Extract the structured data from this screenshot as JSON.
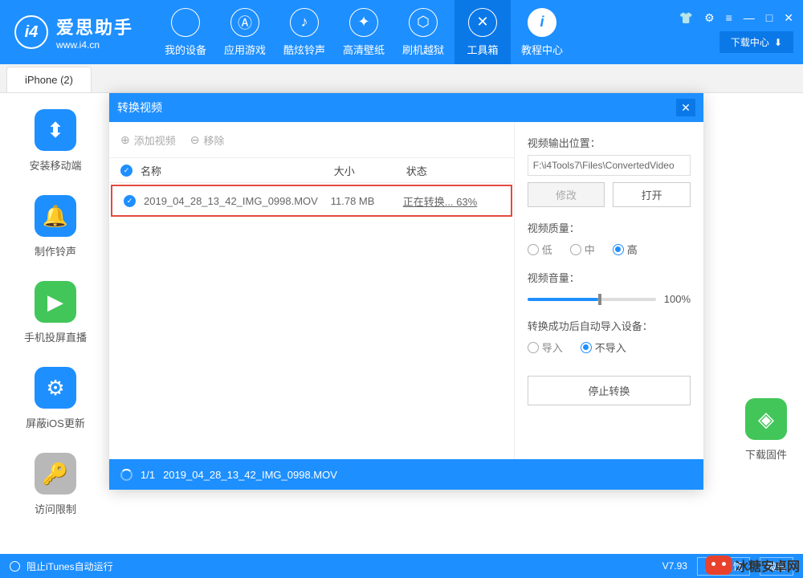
{
  "app": {
    "name": "爱思助手",
    "url": "www.i4.cn"
  },
  "nav": [
    {
      "label": "我的设备"
    },
    {
      "label": "应用游戏"
    },
    {
      "label": "酷炫铃声"
    },
    {
      "label": "高清壁纸"
    },
    {
      "label": "刷机越狱"
    },
    {
      "label": "工具箱"
    },
    {
      "label": "教程中心"
    }
  ],
  "download_center": "下载中心",
  "tab": "iPhone (2)",
  "sidebar": [
    {
      "label": "安装移动端"
    },
    {
      "label": "制作铃声"
    },
    {
      "label": "手机投屏直播"
    },
    {
      "label": "屏蔽iOS更新"
    },
    {
      "label": "访问限制"
    }
  ],
  "right_item": {
    "label": "下载固件"
  },
  "modal": {
    "title": "转换视频",
    "toolbar": {
      "add": "添加视频",
      "remove": "移除"
    },
    "cols": {
      "name": "名称",
      "size": "大小",
      "status": "状态"
    },
    "row": {
      "name": "2019_04_28_13_42_IMG_0998.MOV",
      "size": "11.78 MB",
      "status": "正在转换... 63%"
    },
    "output": {
      "label": "视频输出位置：",
      "path": "F:\\i4Tools7\\Files\\ConvertedVideo",
      "modify": "修改",
      "open": "打开"
    },
    "quality": {
      "label": "视频质量：",
      "low": "低",
      "mid": "中",
      "high": "高"
    },
    "volume": {
      "label": "视频音量：",
      "value": "100%"
    },
    "autoimport": {
      "label": "转换成功后自动导入设备：",
      "yes": "导入",
      "no": "不导入"
    },
    "stop": "停止转换",
    "footer": {
      "count": "1/1",
      "file": "2019_04_28_13_42_IMG_0998.MOV"
    }
  },
  "statusbar": {
    "itunes": "阻止iTunes自动运行",
    "version": "V7.93",
    "feedback": "意见反馈",
    "wechat": "微信"
  },
  "watermark": "冰糖安卓网"
}
